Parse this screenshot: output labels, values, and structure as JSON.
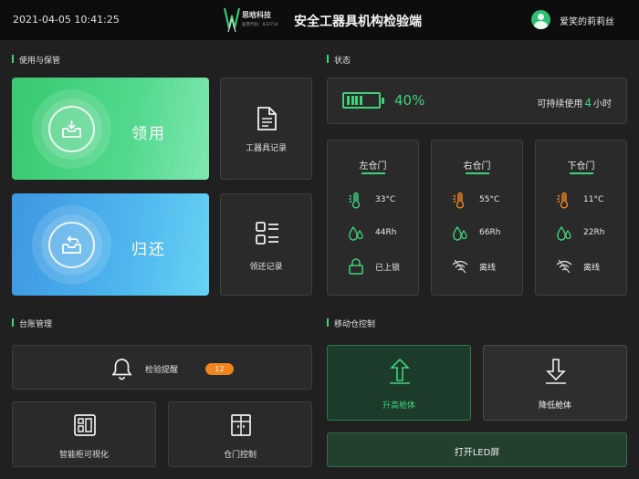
{
  "header": {
    "datetime": "2021-04-05  10:41:25",
    "logo_brand": "思晗科技",
    "logo_sub": "股票代码：832714",
    "title": "安全工器具机构检验端",
    "username": "爱笑的莉莉丝"
  },
  "usage": {
    "section_title": "使用与保管",
    "borrow_label": "领用",
    "return_label": "归还",
    "tool_records_label": "工器具记录",
    "borrow_records_label": "领还记录"
  },
  "status": {
    "section_title": "状态",
    "battery_percent": "40%",
    "battery_level": 0.4,
    "duration_prefix": "可持续使用",
    "duration_value": "4",
    "duration_suffix": "小时",
    "doors": [
      {
        "name": "左仓门",
        "temperature": "33°C",
        "humidity": "44Rh",
        "state": "已上锁",
        "state_icon": "lock-icon",
        "alert": false
      },
      {
        "name": "右仓门",
        "temperature": "55°C",
        "humidity": "66Rh",
        "state": "离线",
        "state_icon": "wifi-icon",
        "alert": true
      },
      {
        "name": "下仓门",
        "temperature": "11°C",
        "humidity": "22Rh",
        "state": "离线",
        "state_icon": "wifi-icon",
        "alert": true
      }
    ]
  },
  "ledger": {
    "section_title": "台账管理",
    "reminder_label": "检验提醒",
    "reminder_count": "12",
    "cabinet_label": "智能柜可视化",
    "door_control_label": "仓门控制"
  },
  "mobile": {
    "section_title": "移动仓控制",
    "raise_label": "升高舱体",
    "lower_label": "降低舱体",
    "led_label": "打开LED屏"
  },
  "colors": {
    "accent_green": "#3fd27a",
    "alert_orange": "#f0841f",
    "background": "#202020",
    "panel": "#2a2a2a"
  }
}
